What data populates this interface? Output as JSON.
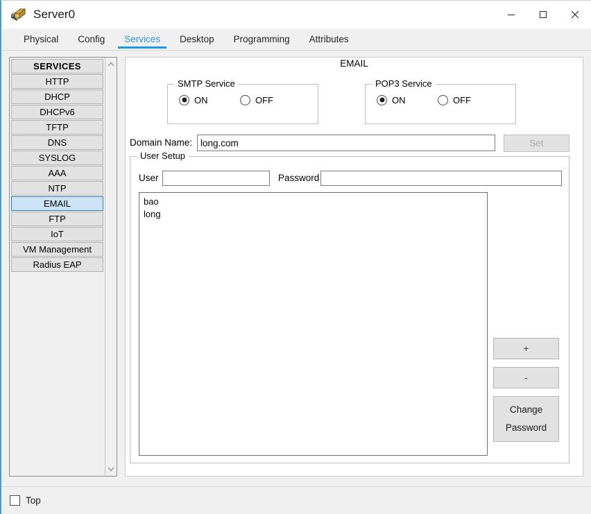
{
  "window": {
    "title": "Server0",
    "icon": "server-device-icon",
    "controls": {
      "minimize": "minimize-icon",
      "maximize": "maximize-icon",
      "close": "close-icon"
    }
  },
  "tabs": [
    {
      "label": "Physical",
      "active": false
    },
    {
      "label": "Config",
      "active": false
    },
    {
      "label": "Services",
      "active": true
    },
    {
      "label": "Desktop",
      "active": false
    },
    {
      "label": "Programming",
      "active": false
    },
    {
      "label": "Attributes",
      "active": false
    }
  ],
  "sidebar": {
    "header": "SERVICES",
    "items": [
      {
        "label": "HTTP",
        "selected": false
      },
      {
        "label": "DHCP",
        "selected": false
      },
      {
        "label": "DHCPv6",
        "selected": false
      },
      {
        "label": "TFTP",
        "selected": false
      },
      {
        "label": "DNS",
        "selected": false
      },
      {
        "label": "SYSLOG",
        "selected": false
      },
      {
        "label": "AAA",
        "selected": false
      },
      {
        "label": "NTP",
        "selected": false
      },
      {
        "label": "EMAIL",
        "selected": true
      },
      {
        "label": "FTP",
        "selected": false
      },
      {
        "label": "IoT",
        "selected": false
      },
      {
        "label": "VM Management",
        "selected": false
      },
      {
        "label": "Radius EAP",
        "selected": false
      }
    ],
    "scroll_up_icon": "chevron-up-icon",
    "scroll_down_icon": "chevron-down-icon"
  },
  "main": {
    "title": "EMAIL",
    "smtp": {
      "group_label": "SMTP Service",
      "on_label": "ON",
      "off_label": "OFF",
      "selected": "ON"
    },
    "pop3": {
      "group_label": "POP3 Service",
      "on_label": "ON",
      "off_label": "OFF",
      "selected": "ON"
    },
    "domain": {
      "label": "Domain Name:",
      "value": "long.com",
      "placeholder": "",
      "set_button": "Set",
      "set_button_enabled": false
    },
    "user_setup": {
      "group_label": "User Setup",
      "user_label": "User",
      "user_value": "",
      "user_placeholder": "",
      "password_label": "Password",
      "password_value": "",
      "password_placeholder": "",
      "users": [
        "bao",
        "long"
      ],
      "buttons": {
        "add": "+",
        "remove": "-",
        "change_password_line1": "Change",
        "change_password_line2": "Password"
      }
    }
  },
  "bottom": {
    "top_checkbox_label": "Top",
    "top_checkbox_checked": false
  },
  "colors": {
    "accent": "#1b9ae0",
    "tab_active_text": "#2c94d8",
    "selection_bg": "#cde4f7",
    "selection_border": "#2e7fc4",
    "panel_bg": "#f0f0f0",
    "item_bg": "#e2e2e2",
    "disabled_text": "#a8a8a8"
  }
}
